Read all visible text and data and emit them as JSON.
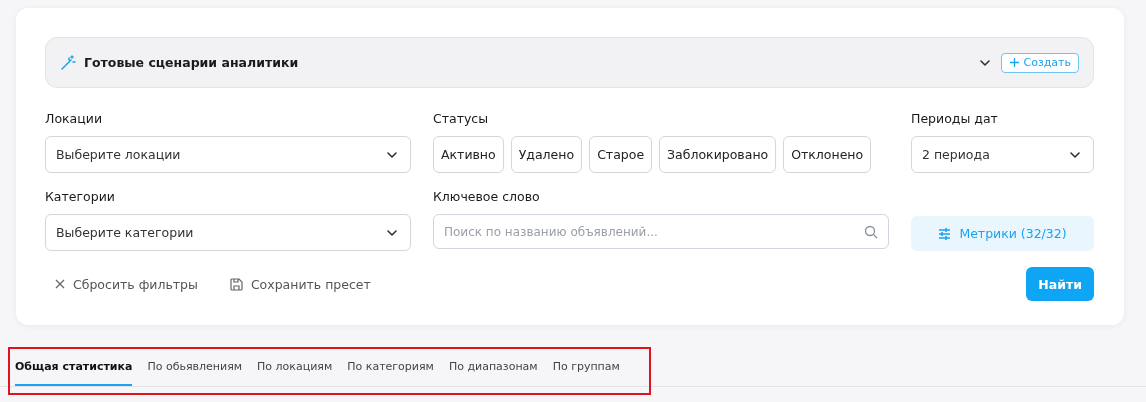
{
  "scenarios": {
    "title": "Готовые сценарии аналитики",
    "create_button": "Создать"
  },
  "filters": {
    "locations": {
      "label": "Локации",
      "placeholder": "Выберите локации"
    },
    "statuses": {
      "label": "Статусы",
      "items": [
        {
          "label": "Активно",
          "selected": false
        },
        {
          "label": "Удалено",
          "selected": false
        },
        {
          "label": "Старое",
          "selected": false
        },
        {
          "label": "Заблокировано",
          "selected": false
        },
        {
          "label": "Отклонено",
          "selected": false
        }
      ]
    },
    "periods": {
      "label": "Периоды дат",
      "value": "2 периода"
    },
    "categories": {
      "label": "Категории",
      "placeholder": "Выберите категории"
    },
    "keyword": {
      "label": "Ключевое слово",
      "placeholder": "Поиск по названию объявлений..."
    },
    "metrics_button": "Метрики (32/32)"
  },
  "actions": {
    "reset": "Сбросить фильтры",
    "save": "Сохранить пресет",
    "find": "Найти"
  },
  "tabs": [
    {
      "label": "Общая статистика",
      "selected": true
    },
    {
      "label": "По обьявлениям",
      "selected": false
    },
    {
      "label": "По локациям",
      "selected": false
    },
    {
      "label": "По категориям",
      "selected": false
    },
    {
      "label": "По диапазонам",
      "selected": false
    },
    {
      "label": "По группам",
      "selected": false
    }
  ],
  "highlight": {
    "shown": true
  }
}
